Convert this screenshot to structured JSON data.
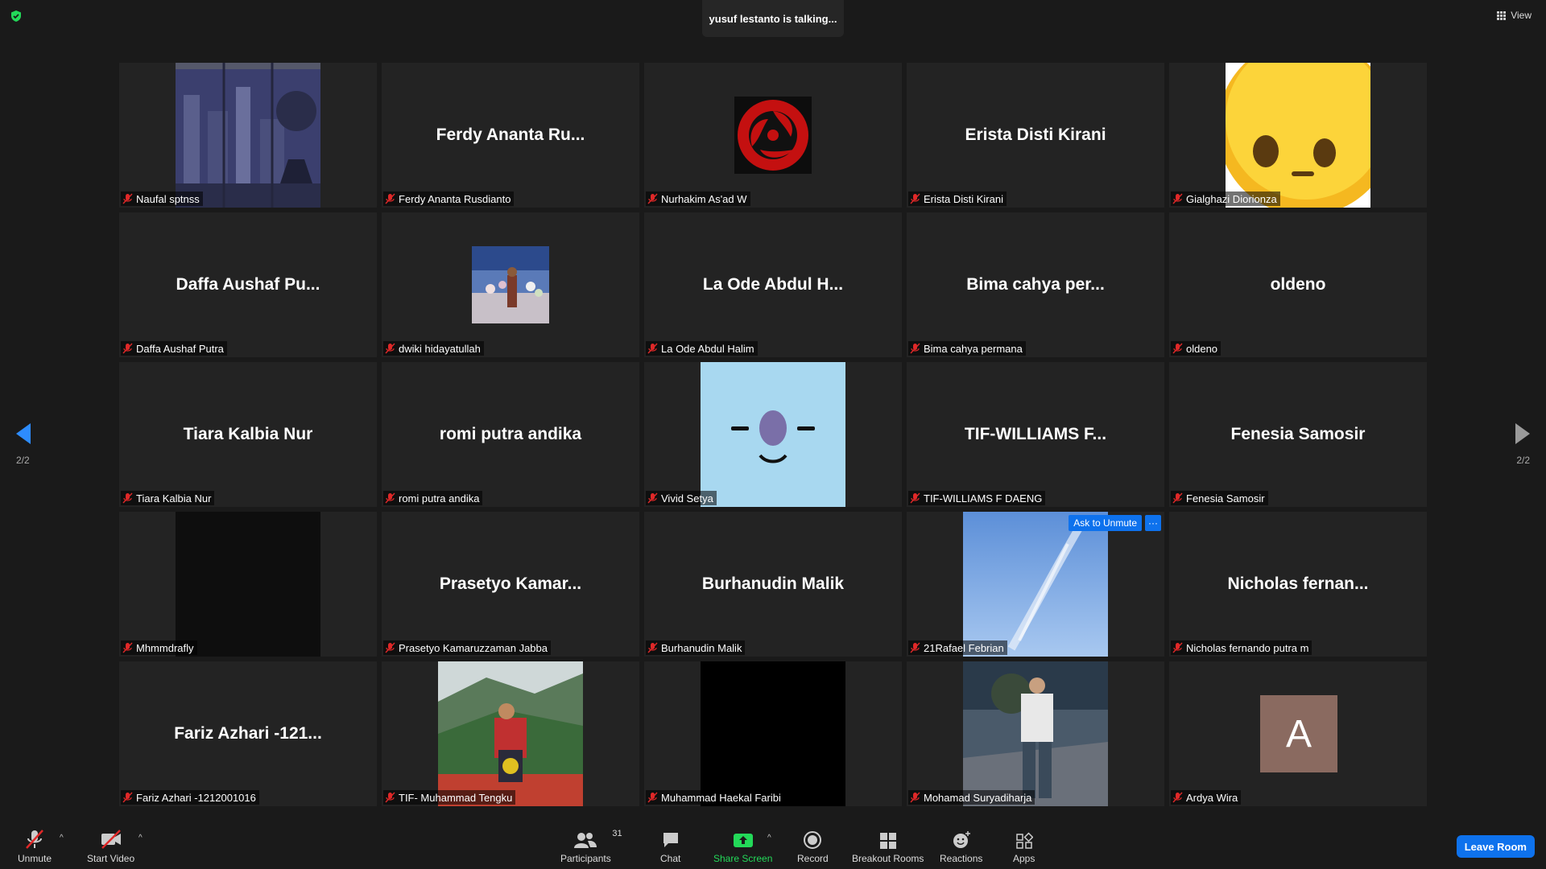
{
  "topbar": {
    "talking": "yusuf lestanto is talking...",
    "view_label": "View"
  },
  "pager": {
    "prev_count": "2/2",
    "next_count": "2/2"
  },
  "tiles": [
    {
      "name": "Naufal sptnss",
      "display": "",
      "media": "photo-city"
    },
    {
      "name": "Ferdy Ananta Rusdianto",
      "display": "Ferdy Ananta Ru...",
      "media": "none"
    },
    {
      "name": "Nurhakim As'ad W",
      "display": "",
      "media": "photo-sharingan"
    },
    {
      "name": "Erista Disti Kirani",
      "display": "Erista Disti Kirani",
      "media": "none"
    },
    {
      "name": "Gialghazi Diorionza",
      "display": "",
      "media": "photo-emoji"
    },
    {
      "name": "Daffa Aushaf Putra",
      "display": "Daffa Aushaf Pu...",
      "media": "none"
    },
    {
      "name": "dwiki hidayatullah",
      "display": "",
      "media": "photo-wedding"
    },
    {
      "name": "La Ode Abdul Halim",
      "display": "La Ode Abdul H...",
      "media": "none"
    },
    {
      "name": "Bima cahya permana",
      "display": "Bima cahya per...",
      "media": "none"
    },
    {
      "name": "oldeno",
      "display": "oldeno",
      "media": "none"
    },
    {
      "name": "Tiara Kalbia Nur",
      "display": "Tiara Kalbia Nur",
      "media": "none"
    },
    {
      "name": "romi putra andika",
      "display": "romi putra andika",
      "media": "none"
    },
    {
      "name": "Vivid Setya",
      "display": "",
      "media": "photo-face"
    },
    {
      "name": "TIF-WILLIAMS F DAENG",
      "display": "TIF-WILLIAMS  F...",
      "media": "none"
    },
    {
      "name": "Fenesia Samosir",
      "display": "Fenesia Samosir",
      "media": "none"
    },
    {
      "name": "Mhmmdrafly",
      "display": "",
      "media": "photo-dark"
    },
    {
      "name": "Prasetyo Kamaruzzaman Jabba",
      "display": "Prasetyo Kamar...",
      "media": "none"
    },
    {
      "name": "Burhanudin Malik",
      "display": "Burhanudin Malik",
      "media": "none"
    },
    {
      "name": "21Rafael Febrian",
      "display": "",
      "media": "photo-sky",
      "ask_unmute": "Ask to Unmute",
      "more": "···"
    },
    {
      "name": "Nicholas fernando putra m",
      "display": "Nicholas  fernan...",
      "media": "none"
    },
    {
      "name": "Fariz Azhari -1212001016",
      "display": "Fariz Azhari -121...",
      "media": "none"
    },
    {
      "name": "TIF- Muhammad Tengku",
      "display": "",
      "media": "photo-mountain"
    },
    {
      "name": "Muhammad Haekal Faribi",
      "display": "",
      "media": "photo-black"
    },
    {
      "name": "Mohamad Suryadiharja",
      "display": "",
      "media": "photo-street"
    },
    {
      "name": "Ardya Wira",
      "display": "",
      "media": "avatar-A",
      "avatar_letter": "A"
    }
  ],
  "toolbar": {
    "unmute": "Unmute",
    "start_video": "Start Video",
    "participants": "Participants",
    "participants_count": "31",
    "chat": "Chat",
    "share_screen": "Share Screen",
    "record": "Record",
    "breakout_rooms": "Breakout Rooms",
    "reactions": "Reactions",
    "apps": "Apps",
    "leave": "Leave Room"
  },
  "colors": {
    "accent": "#0e72ed",
    "share_green": "#23d959",
    "muted_red": "#e02828",
    "avatar_bg": "#8a6a60"
  }
}
